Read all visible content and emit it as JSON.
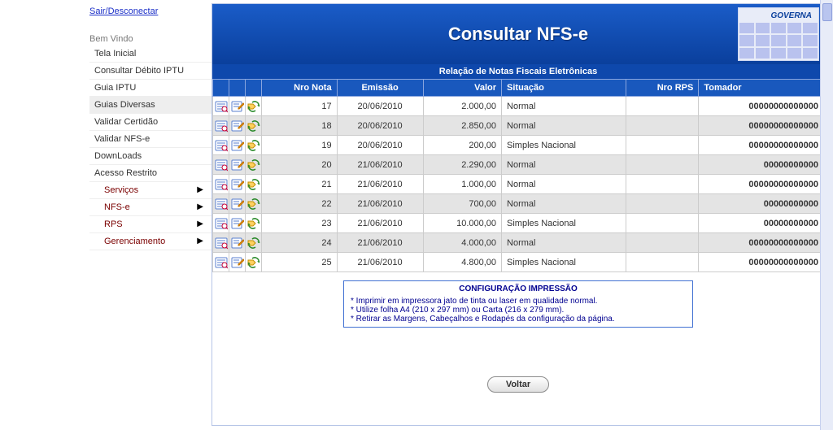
{
  "logout_label": "Sair/Desconectar",
  "welcome_label": "Bem Vindo",
  "menu": {
    "tela_inicial": "Tela Inicial",
    "consultar_debito_iptu": "Consultar Débito IPTU",
    "guia_iptu": "Guia IPTU",
    "guias_diversas": "Guias Diversas",
    "validar_certidao": "Validar Certidão",
    "validar_nfse": "Validar NFS-e",
    "downloads": "DownLoads",
    "acesso_restrito": "Acesso Restrito",
    "servicos": "Serviços",
    "nfse": "NFS-e",
    "rps": "RPS",
    "gerenciamento": "Gerenciamento"
  },
  "panel": {
    "title": "Consultar NFS-e",
    "logo_text": "GOVERNA",
    "table_title": "Relação de Notas Fiscais Eletrônicas",
    "columns": {
      "nro_nota": "Nro Nota",
      "emissao": "Emissão",
      "valor": "Valor",
      "situacao": "Situação",
      "nro_rps": "Nro RPS",
      "tomador": "Tomador"
    },
    "rows": [
      {
        "nro_nota": "17",
        "emissao": "20/06/2010",
        "valor": "2.000,00",
        "situacao": "Normal",
        "nro_rps": "",
        "tomador": "00000000000000"
      },
      {
        "nro_nota": "18",
        "emissao": "20/06/2010",
        "valor": "2.850,00",
        "situacao": "Normal",
        "nro_rps": "",
        "tomador": "00000000000000"
      },
      {
        "nro_nota": "19",
        "emissao": "20/06/2010",
        "valor": "200,00",
        "situacao": "Simples Nacional",
        "nro_rps": "",
        "tomador": "00000000000000"
      },
      {
        "nro_nota": "20",
        "emissao": "21/06/2010",
        "valor": "2.290,00",
        "situacao": "Normal",
        "nro_rps": "",
        "tomador": "00000000000"
      },
      {
        "nro_nota": "21",
        "emissao": "21/06/2010",
        "valor": "1.000,00",
        "situacao": "Normal",
        "nro_rps": "",
        "tomador": "00000000000000"
      },
      {
        "nro_nota": "22",
        "emissao": "21/06/2010",
        "valor": "700,00",
        "situacao": "Normal",
        "nro_rps": "",
        "tomador": "00000000000"
      },
      {
        "nro_nota": "23",
        "emissao": "21/06/2010",
        "valor": "10.000,00",
        "situacao": "Simples Nacional",
        "nro_rps": "",
        "tomador": "00000000000"
      },
      {
        "nro_nota": "24",
        "emissao": "21/06/2010",
        "valor": "4.000,00",
        "situacao": "Normal",
        "nro_rps": "",
        "tomador": "00000000000000"
      },
      {
        "nro_nota": "25",
        "emissao": "21/06/2010",
        "valor": "4.800,00",
        "situacao": "Simples Nacional",
        "nro_rps": "",
        "tomador": "00000000000000"
      }
    ],
    "icons": {
      "view": "view-icon",
      "edit": "edit-icon",
      "tag": "tag-icon"
    },
    "config": {
      "title": "CONFIGURAÇÃO IMPRESSÃO",
      "line1": "Imprimir em impressora jato de tinta ou laser em qualidade normal.",
      "line2": "Utilize folha A4 (210 x 297 mm) ou Carta (216 x 279 mm).",
      "line3": "Retirar as Margens, Cabeçalhos e Rodapés da configuração da página."
    },
    "voltar_label": "Voltar"
  }
}
